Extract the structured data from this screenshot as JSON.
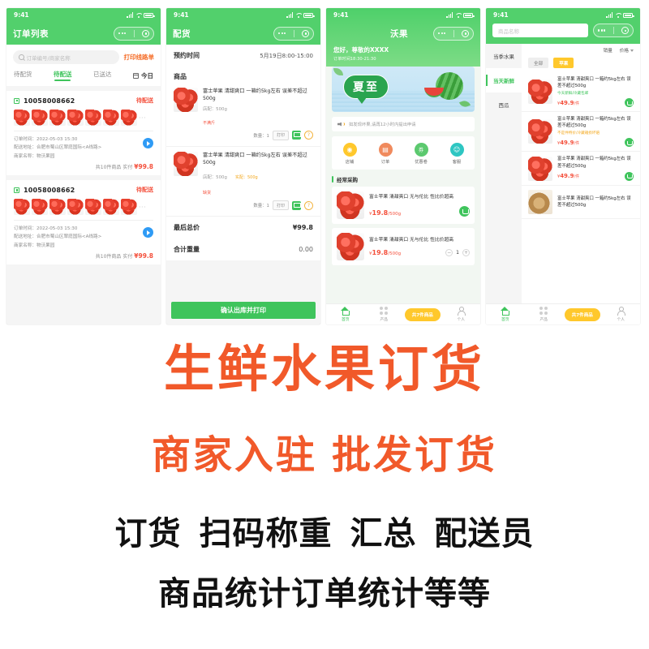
{
  "status_bar": {
    "time": "9:41"
  },
  "screen1": {
    "nav_title": "订单列表",
    "search_placeholder": "订单编号/商家名称",
    "print_label": "打印线路单",
    "tabs": [
      {
        "label": "待配货",
        "active": false
      },
      {
        "label": "待配送",
        "active": true
      },
      {
        "label": "已送达",
        "active": false
      }
    ],
    "date_filter": "今日",
    "orders": [
      {
        "id": "10058008662",
        "status": "待配送",
        "time_label": "订单时间：",
        "time_value": "2022-05-03 15:30",
        "address_label": "配送地址：",
        "address_value": "合肥市蜀山区翠庭国际<A线路>",
        "merchant_label": "商家名称：",
        "merchant_value": "物沃果园",
        "total_prefix": "共10件商品 实付",
        "total_amount": "¥99.8",
        "thumb_count": 7,
        "more": "···"
      },
      {
        "id": "10058008662",
        "status": "待配送",
        "time_label": "订单时间：",
        "time_value": "2022-05-03 15:30",
        "address_label": "配送地址：",
        "address_value": "合肥市蜀山区翠庭国际<A线路>",
        "merchant_label": "商家名称：",
        "merchant_value": "物沃果园",
        "total_prefix": "共10件商品 实付",
        "total_amount": "¥99.8",
        "thumb_count": 7,
        "more": "···"
      }
    ]
  },
  "screen2": {
    "nav_title": "配货",
    "appointment_label": "预约时间",
    "appointment_value": "5月19日8:00-15:00",
    "goods_title": "商品",
    "items": [
      {
        "name": "富士苹果 清甜爽口 一箱约5kg左右 误差不超过500g",
        "spec": "店配：500g",
        "tag_red": "不满斤",
        "tag_yellow": "",
        "qty_label": "数量：1",
        "print_btn": "打印",
        "weight_note": ""
      },
      {
        "name": "富士苹果 清甜爽口 一箱约5kg左右 误差不超过500g",
        "spec": "店配：500g",
        "tag_red": "缺货",
        "tag_yellow": "实配：500g",
        "qty_label": "数量：1",
        "print_btn": "打印",
        "weight_note": ""
      }
    ],
    "final_price_label": "最后总价",
    "final_price_value": "¥99.8",
    "total_weight_label": "合计重量",
    "total_weight_value": "0.00",
    "confirm_button": "确认出库并打印"
  },
  "screen3": {
    "nav_title": "沃果",
    "greeting": "您好，尊敬的XXXX",
    "order_time": "订单时间18:30-21:30",
    "banner_text": "夏至",
    "notice": "如发现坏果,请再12小时内提出申请",
    "quick_icons": [
      {
        "label": "店铺",
        "color": "#ffc82c",
        "glyph": "◉"
      },
      {
        "label": "订单",
        "color": "#f08a5d",
        "glyph": "▤"
      },
      {
        "label": "优惠卷",
        "color": "#5cc96f",
        "glyph": "券"
      },
      {
        "label": "客服",
        "color": "#2ec6c2",
        "glyph": "☺"
      }
    ],
    "section_title": "经常采购",
    "products": [
      {
        "name": "富士苹果 清甜爽口 无与伦比 性比价超高",
        "price_num": "19.8",
        "price_unit": "/500g",
        "currency": "¥",
        "control": "cart"
      },
      {
        "name": "富士苹果 清甜爽口 无与伦比 性比价超高",
        "price_num": "19.8",
        "price_unit": "/500g",
        "currency": "¥",
        "control": "stepper",
        "qty": "1"
      }
    ],
    "tabbar": [
      {
        "label": "首页",
        "icon": "home-icon",
        "active": true
      },
      {
        "label": "产品",
        "icon": "grid-icon",
        "active": false
      },
      {
        "label": "共7件商品",
        "icon": "cart-pill",
        "active": false
      },
      {
        "label": "个人",
        "icon": "user-icon",
        "active": false
      }
    ]
  },
  "screen4": {
    "search_placeholder": "商品名称",
    "categories": [
      {
        "label": "当季水果",
        "active": false
      },
      {
        "label": "当天新鲜",
        "active": true
      },
      {
        "label": "西瓜",
        "active": false
      }
    ],
    "sort": [
      {
        "label": "销量"
      },
      {
        "label": "价格"
      }
    ],
    "chips": [
      {
        "label": "全部",
        "active": false
      },
      {
        "label": "苹果",
        "active": true
      }
    ],
    "items": [
      {
        "name": "富士苹果 清甜爽口 一箱约5kg左右 误差不超过500g",
        "badge": "今天新鲜/冷藏包邮",
        "badge_color": "green",
        "price_num": "49.9",
        "price_unit": "/件",
        "currency": "¥",
        "image": "apple"
      },
      {
        "name": "富士苹果 清甜爽口 一箱约5kg左右 误差不超过500g",
        "badge": "不是件特价/冷藏箱损坏赔",
        "badge_color": "yellow",
        "price_num": "49.9",
        "price_unit": "/件",
        "currency": "¥",
        "image": "apple"
      },
      {
        "name": "富士苹果 清甜爽口 一箱约5kg左右 误差不超过500g",
        "badge": "",
        "badge_color": "green",
        "price_num": "49.9",
        "price_unit": "/件",
        "currency": "¥",
        "image": "apple"
      },
      {
        "name": "富士苹果 清甜爽口 一箱约5kg左右 误差不超过500g",
        "badge": "",
        "badge_color": "green",
        "price_num": "",
        "price_unit": "",
        "currency": "",
        "image": "pear"
      }
    ],
    "tabbar": [
      {
        "label": "首页",
        "icon": "home-icon",
        "active": true
      },
      {
        "label": "产品",
        "icon": "grid-icon",
        "active": false
      },
      {
        "label": "共7件商品",
        "icon": "cart-pill",
        "active": false
      },
      {
        "label": "个人",
        "icon": "user-icon",
        "active": false
      }
    ]
  },
  "marketing": {
    "headline1": "生鲜水果订货",
    "headline2_a": "商家入驻",
    "headline2_b": "批发订货",
    "features_row1": [
      "订货",
      "扫码称重",
      "汇总",
      "配送员"
    ],
    "features_row2": [
      "商品统计",
      "订单统计",
      "等等"
    ],
    "accent_orange": "#f1592a",
    "accent_green": "#52d06c",
    "accent_yellow": "#ffc82c"
  }
}
